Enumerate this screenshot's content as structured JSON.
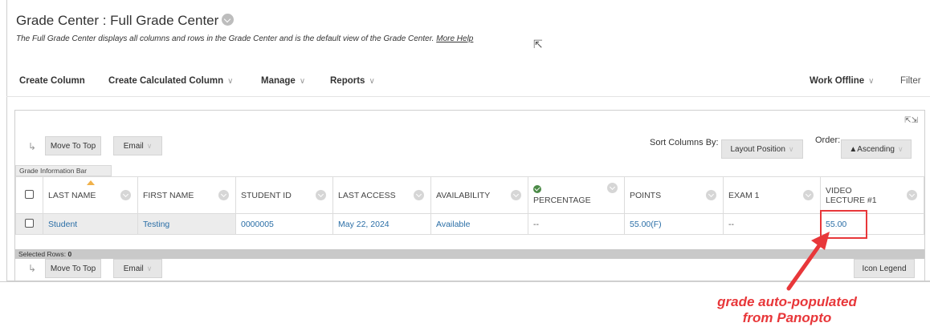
{
  "header": {
    "title": "Grade Center : Full Grade Center",
    "subtitle": "The Full Grade Center displays all columns and rows in the Grade Center and is the default view of the Grade Center.",
    "help_link": "More Help"
  },
  "toolbar": {
    "create_column": "Create Column",
    "create_calculated_column": "Create Calculated Column",
    "manage": "Manage",
    "reports": "Reports",
    "work_offline": "Work Offline",
    "filter": "Filter"
  },
  "grid_controls": {
    "move_to_top": "Move To Top",
    "email": "Email",
    "sort_columns_by_label": "Sort Columns By:",
    "sort_columns_by_value": "Layout Position",
    "order_label": "Order:",
    "order_value": "▲Ascending",
    "info_bar": "Grade Information Bar",
    "icon_legend": "Icon Legend"
  },
  "columns": [
    "LAST NAME",
    "FIRST NAME",
    "STUDENT ID",
    "LAST ACCESS",
    "AVAILABILITY",
    "PERCENTAGE",
    "POINTS",
    "EXAM 1",
    "VIDEO LECTURE #1"
  ],
  "rows": [
    {
      "last_name": "Student",
      "first_name": "Testing",
      "student_id": "0000005",
      "last_access": "May 22, 2024",
      "availability": "Available",
      "percentage": "--",
      "points": "55.00(F)",
      "exam_1": "--",
      "video_lecture_1": "55.00"
    }
  ],
  "selected_rows": {
    "label": "Selected Rows:",
    "count": "0"
  },
  "annotation": {
    "line1": "grade auto-populated",
    "line2": "from Panopto",
    "color": "#e8373a"
  },
  "icons": [
    "title-options-icon",
    "cursor-icon",
    "expand-icon",
    "sort-ascending-icon",
    "column-options-icon",
    "grade-check-icon",
    "select-checkbox"
  ]
}
